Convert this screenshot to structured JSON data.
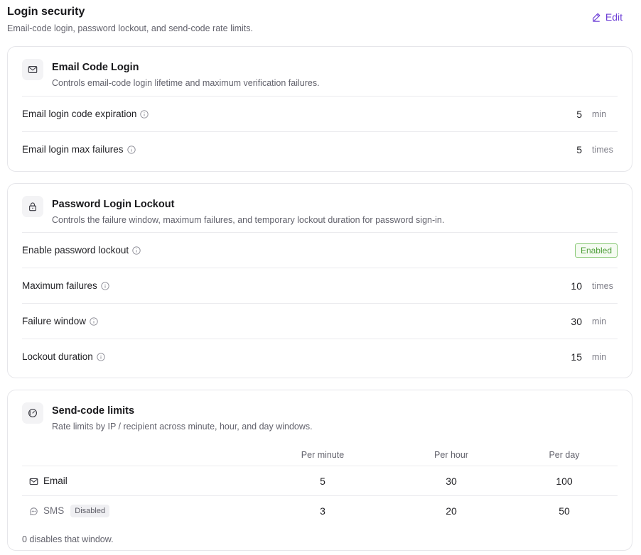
{
  "header": {
    "title": "Login security",
    "subtitle": "Email-code login, password lockout, and send-code rate limits.",
    "edit_label": "Edit"
  },
  "email_code": {
    "title": "Email Code Login",
    "description": "Controls email-code login lifetime and maximum verification failures.",
    "icon": "mail-icon",
    "rows": [
      {
        "label": "Email login code expiration",
        "value": "5",
        "unit": "min"
      },
      {
        "label": "Email login max failures",
        "value": "5",
        "unit": "times"
      }
    ]
  },
  "password_lockout": {
    "title": "Password Login Lockout",
    "description": "Controls the failure window, maximum failures, and temporary lockout duration for password sign-in.",
    "icon": "lock-icon",
    "enable_label": "Enable password lockout",
    "enable_status": "Enabled",
    "rows": [
      {
        "label": "Maximum failures",
        "value": "10",
        "unit": "times"
      },
      {
        "label": "Failure window",
        "value": "30",
        "unit": "min"
      },
      {
        "label": "Lockout duration",
        "value": "15",
        "unit": "min"
      }
    ]
  },
  "send_code": {
    "title": "Send-code limits",
    "description": "Rate limits by IP / recipient across minute, hour, and day windows.",
    "icon": "gauge-icon",
    "columns": [
      "Per minute",
      "Per hour",
      "Per day"
    ],
    "rows": [
      {
        "label": "Email",
        "icon": "mail-icon",
        "badge": "",
        "values": [
          "5",
          "30",
          "100"
        ]
      },
      {
        "label": "SMS",
        "icon": "message-icon",
        "badge": "Disabled",
        "values": [
          "3",
          "20",
          "50"
        ]
      }
    ],
    "footnote": "0 disables that window."
  },
  "colors": {
    "accent": "#6d3fd6",
    "enabled_green": "#4e9e3a",
    "border": "#e6e6ea"
  }
}
